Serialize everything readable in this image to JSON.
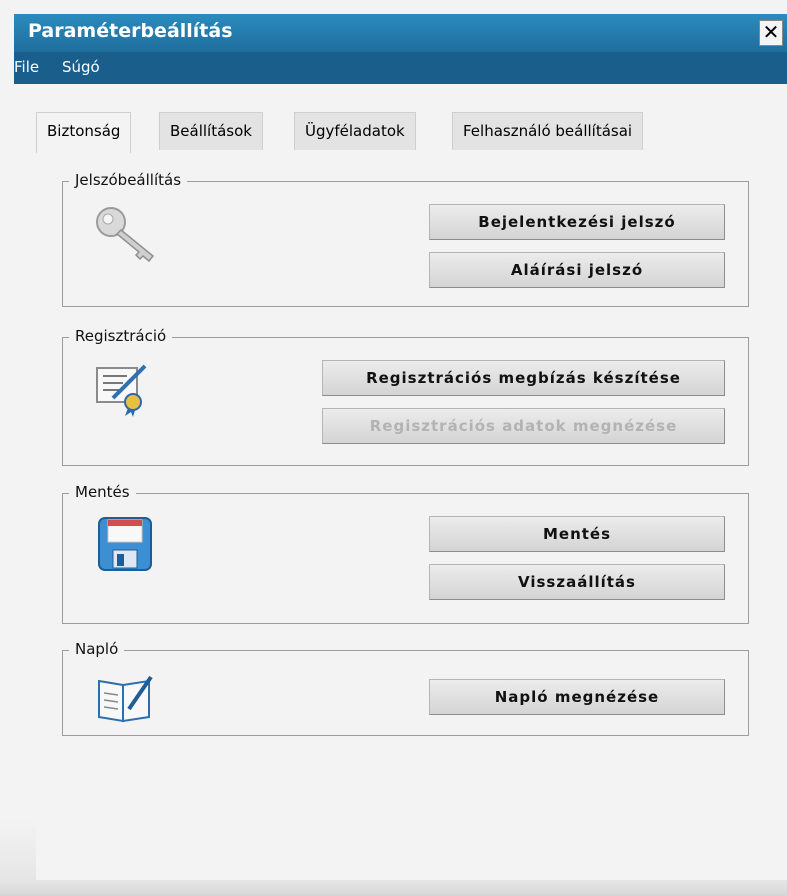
{
  "window": {
    "title": "Paraméterbeállítás",
    "close_label": "✕"
  },
  "menu": {
    "items": [
      "File",
      "Súgó"
    ]
  },
  "tabs": [
    "Biztonság",
    "Beállítások",
    "Ügyféladatok",
    "Felhasználó beállításai"
  ],
  "active_tab": "Biztonság",
  "groups": {
    "password": {
      "legend": "Jelszóbeállítás",
      "buttons": [
        "Bejelentkezési jelszó",
        "Aláírási jelszó"
      ],
      "icon": "key-icon"
    },
    "registration": {
      "legend": "Regisztráció",
      "buttons": [
        "Regisztrációs megbízás készítése",
        "Regisztrációs adatok megnézése"
      ],
      "disabled_button": "Regisztrációs adatok megnézése",
      "icon": "certificate-icon"
    },
    "backup": {
      "legend": "Mentés",
      "buttons": [
        "Mentés",
        "Visszaállítás"
      ],
      "icon": "floppy-disk-icon"
    },
    "log": {
      "legend": "Napló",
      "buttons": [
        "Napló megnézése"
      ],
      "icon": "log-book-icon"
    }
  },
  "colors": {
    "titlebar": "#2b8bbe",
    "menubar": "#1a5f8c",
    "panel": "#f3f3f3"
  }
}
